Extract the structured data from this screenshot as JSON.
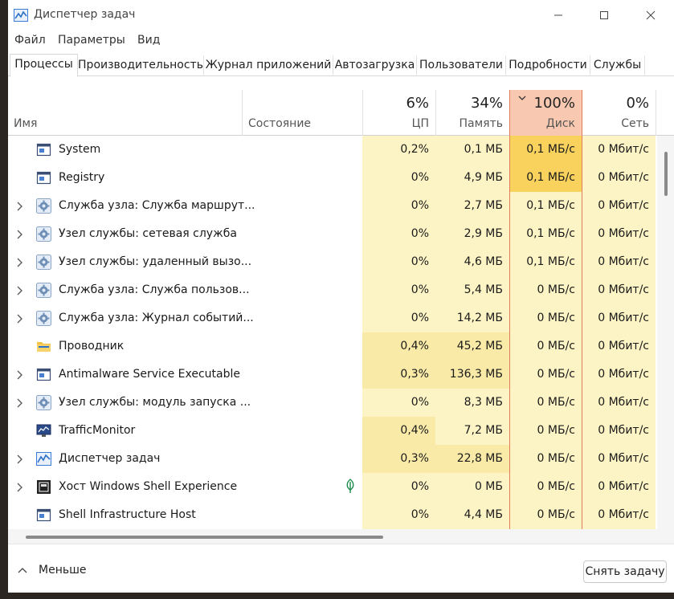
{
  "window": {
    "title": "Диспетчер задач"
  },
  "menu": [
    "Файл",
    "Параметры",
    "Вид"
  ],
  "tabs": [
    "Процессы",
    "Производительность",
    "Журнал приложений",
    "Автозагрузка",
    "Пользователи",
    "Подробности",
    "Службы"
  ],
  "columns": {
    "name": "Имя",
    "status": "Состояние",
    "cpu": {
      "pct": "6%",
      "label": "ЦП"
    },
    "memory": {
      "pct": "34%",
      "label": "Память"
    },
    "disk": {
      "pct": "100%",
      "label": "Диск"
    },
    "network": {
      "pct": "0%",
      "label": "Сеть"
    }
  },
  "processes": [
    {
      "name": "System",
      "icon": "app-window-icon",
      "expandable": false,
      "cpu": "0,2%",
      "mem": "0,1 МБ",
      "disk": "0,1 МБ/с",
      "net": "0 Мбит/с",
      "disk_hot": true
    },
    {
      "name": "Registry",
      "icon": "app-window-icon",
      "expandable": false,
      "cpu": "0%",
      "mem": "4,9 МБ",
      "disk": "0,1 МБ/с",
      "net": "0 Мбит/с",
      "disk_hot": true
    },
    {
      "name": "Служба узла: Служба маршрут...",
      "icon": "gear-icon",
      "expandable": true,
      "cpu": "0%",
      "mem": "2,7 МБ",
      "disk": "0,1 МБ/с",
      "net": "0 Мбит/с"
    },
    {
      "name": "Узел службы: сетевая служба",
      "icon": "gear-icon",
      "expandable": true,
      "cpu": "0%",
      "mem": "2,9 МБ",
      "disk": "0,1 МБ/с",
      "net": "0 Мбит/с"
    },
    {
      "name": "Узел службы: удаленный вызо...",
      "icon": "gear-icon",
      "expandable": true,
      "cpu": "0%",
      "mem": "4,6 МБ",
      "disk": "0,1 МБ/с",
      "net": "0 Мбит/с"
    },
    {
      "name": "Служба узла: Служба пользов...",
      "icon": "gear-icon",
      "expandable": true,
      "cpu": "0%",
      "mem": "5,4 МБ",
      "disk": "0 МБ/с",
      "net": "0 Мбит/с"
    },
    {
      "name": "Служба узла: Журнал событий...",
      "icon": "gear-icon",
      "expandable": true,
      "cpu": "0%",
      "mem": "14,2 МБ",
      "disk": "0 МБ/с",
      "net": "0 Мбит/с"
    },
    {
      "name": "Проводник",
      "icon": "folder-icon",
      "expandable": false,
      "cpu": "0,4%",
      "mem": "45,2 МБ",
      "disk": "0 МБ/с",
      "net": "0 Мбит/с",
      "cpu_hot": true,
      "mem_hot": true
    },
    {
      "name": "Antimalware Service Executable",
      "icon": "app-window-icon",
      "expandable": true,
      "cpu": "0,3%",
      "mem": "136,3 МБ",
      "disk": "0 МБ/с",
      "net": "0 Мбит/с",
      "cpu_hot": true,
      "mem_hot": true
    },
    {
      "name": "Узел службы: модуль запуска ...",
      "icon": "gear-icon",
      "expandable": true,
      "cpu": "0%",
      "mem": "8,3 МБ",
      "disk": "0 МБ/с",
      "net": "0 Мбит/с"
    },
    {
      "name": "TrafficMonitor",
      "icon": "monitor-icon",
      "expandable": false,
      "cpu": "0,4%",
      "mem": "7,2 МБ",
      "disk": "0 МБ/с",
      "net": "0 Мбит/с",
      "cpu_hot": true
    },
    {
      "name": "Диспетчер задач",
      "icon": "taskmgr-icon",
      "expandable": true,
      "cpu": "0,3%",
      "mem": "22,8 МБ",
      "disk": "0 МБ/с",
      "net": "0 Мбит/с",
      "cpu_hot": true,
      "mem_hot": true
    },
    {
      "name": "Хост Windows Shell Experience",
      "icon": "shell-icon",
      "expandable": true,
      "cpu": "0%",
      "mem": "0 МБ",
      "disk": "0 МБ/с",
      "net": "0 Мбит/с",
      "suspended": true
    },
    {
      "name": "Shell Infrastructure Host",
      "icon": "app-window-icon",
      "expandable": false,
      "cpu": "0%",
      "mem": "4,4 МБ",
      "disk": "0 МБ/с",
      "net": "0 Мбит/с"
    }
  ],
  "footer": {
    "less": "Меньше",
    "end_task": "Снять задачу"
  },
  "colors": {
    "heat_light": "#fdf4c5",
    "heat_mid": "#faeaa8",
    "heat_hot": "#f9d25e",
    "disk_header": "#f8c9b0",
    "disk_border": "#e17b5a"
  }
}
